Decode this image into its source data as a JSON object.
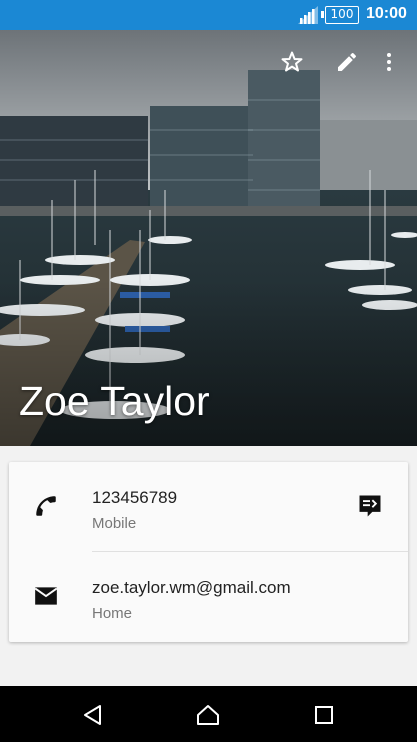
{
  "status_bar": {
    "battery_level": "100",
    "time": "10:00",
    "icons": [
      "signal-icon",
      "battery-icon"
    ],
    "background": "#1b88d4"
  },
  "contact": {
    "name": "Zoe Taylor",
    "actions": [
      "star-icon",
      "edit-icon",
      "more-icon"
    ]
  },
  "details": {
    "phone": {
      "value": "123456789",
      "type": "Mobile",
      "icon": "phone-icon",
      "action_icon": "message-icon"
    },
    "email": {
      "value": "zoe.taylor.wm@gmail.com",
      "type": "Home",
      "icon": "email-icon"
    }
  },
  "nav_bar": {
    "icons": [
      "back-icon",
      "home-icon",
      "recents-icon"
    ]
  }
}
